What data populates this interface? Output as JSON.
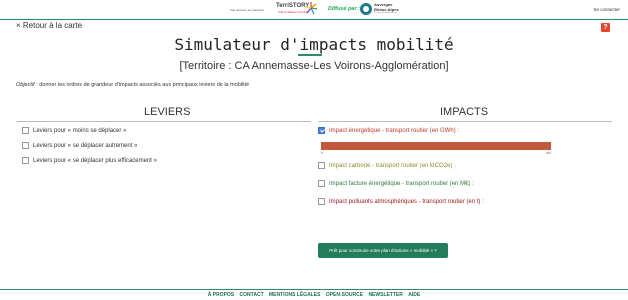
{
  "header": {
    "tagline": "Voir territoire en transition",
    "brand": "TerriSTORY",
    "brand_sub": "Outil de dialogue territorial",
    "diffuse": "Diffusé par :",
    "region_name_1": "Auvergne",
    "region_name_2": "Rhône-Alpes",
    "region_sub": "Énergie Environnement",
    "connect": "Se connecter"
  },
  "nav": {
    "back": "× Retour à la carte",
    "help": "?"
  },
  "page": {
    "title_part1": "Simulateur d'",
    "title_accent": "imp",
    "title_part2": "acts mobilité",
    "subtitle": "[Territoire : CA Annemasse-Les Voirons-Agglomération]",
    "objective_label": "Objectif",
    "objective_text": " : donner les ordres de grandeur d'impacts associés aux principaux leviers de la mobilité"
  },
  "leviers": {
    "title": "LEVIERS",
    "items": [
      {
        "label": "Leviers pour « moins se déplacer »",
        "checked": false
      },
      {
        "label": "Leviers pour « se déplacer autrement »",
        "checked": false
      },
      {
        "label": "Leviers pour « se déplacer plus efficacement »",
        "checked": false
      }
    ]
  },
  "impacts": {
    "title": "IMPACTS",
    "items": [
      {
        "label": "Impact énergétique - transport routier (en GWh) :",
        "checked": true,
        "color": "#c0392b"
      },
      {
        "label": "Impact carbone - transport routier (en ktCO2e) :",
        "checked": false,
        "color": "#8a8a2a"
      },
      {
        "label": "Impact facture énergétique - transport routier (en M€) :",
        "checked": false,
        "color": "#2d7a3a"
      },
      {
        "label": "Impact polluants atmosphériques - transport routier (en t) :",
        "checked": false,
        "color": "#a01c1c"
      }
    ],
    "bar": {
      "min_label": "0",
      "max_label": "467",
      "value": 467,
      "max": 467,
      "color": "#c05a3b"
    }
  },
  "cta": {
    "label": "Prêt pour construire votre plan d'actions « mobilité » ?"
  },
  "footer": {
    "links": [
      "À PROPOS",
      "CONTACT",
      "MENTIONS LÉGALES",
      "OPEN-SOURCE",
      "NEWSLETTER",
      "AIDE"
    ]
  }
}
